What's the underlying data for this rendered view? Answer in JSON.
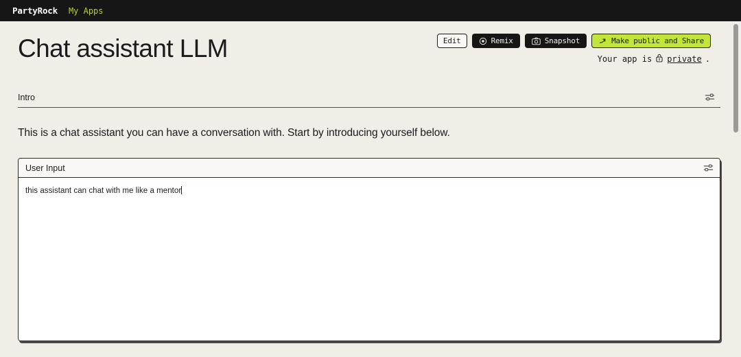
{
  "nav": {
    "brand": "PartyRock",
    "my_apps": "My Apps"
  },
  "header": {
    "title": "Chat assistant LLM",
    "buttons": [
      {
        "label": "Edit",
        "icon": "",
        "style": "light"
      },
      {
        "label": "Remix",
        "icon": "remix-icon",
        "style": "dark"
      },
      {
        "label": "Snapshot",
        "icon": "camera-icon",
        "style": "dark"
      },
      {
        "label": "Make public and Share",
        "icon": "arrow-up-right-icon",
        "style": "accent"
      }
    ],
    "privacy_prefix": "Your app is",
    "privacy_value": "private",
    "privacy_suffix": "."
  },
  "intro_widget": {
    "label": "Intro",
    "settings_icon": "sliders-icon",
    "body": "This is a chat assistant you can have a conversation with. Start by introducing yourself below."
  },
  "input_widget": {
    "label": "User Input",
    "settings_icon": "sliders-icon",
    "value": "this assistant can chat with me like a mentor",
    "placeholder": ""
  },
  "colors": {
    "page_background": "#f1ede7",
    "nav_background": "#161616",
    "accent": "#c3e53a",
    "nav_link": "#b4d235",
    "text": "#1b1b1b",
    "panel_background": "#ffffff",
    "panel_head_background": "#faf8f5",
    "scrollbar_thumb": "#9a9a98"
  }
}
